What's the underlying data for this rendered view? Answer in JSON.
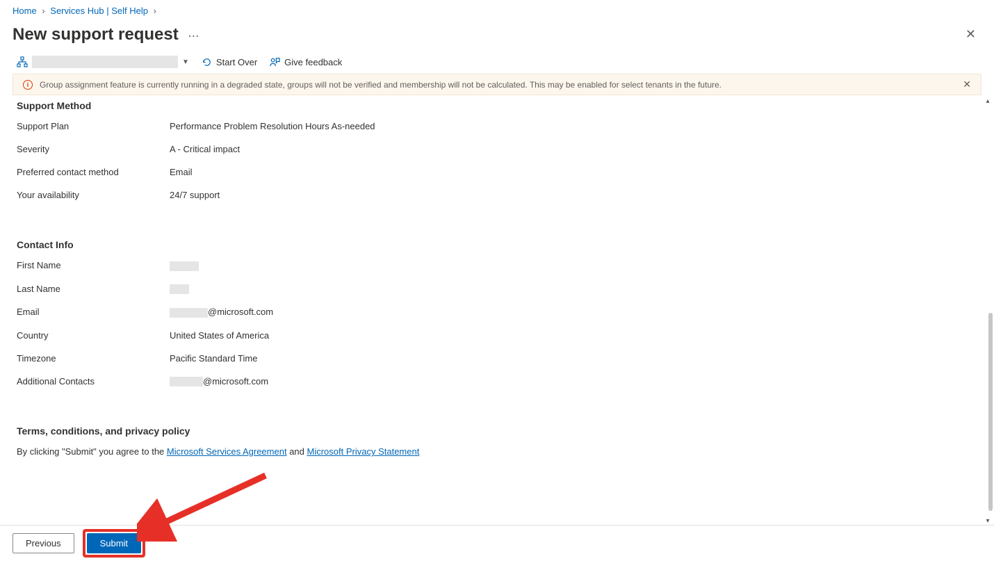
{
  "breadcrumb": {
    "home": "Home",
    "serviceshub": "Services Hub | Self Help"
  },
  "page_title": "New support request",
  "toolbar": {
    "start_over": "Start Over",
    "give_feedback": "Give feedback"
  },
  "notice": {
    "text": "Group assignment feature is currently running in a degraded state, groups will not be verified and membership will not be calculated. This may be enabled for select tenants in the future."
  },
  "support_method": {
    "title": "Support Method",
    "rows": [
      {
        "label": "Support Plan",
        "value": "Performance Problem Resolution Hours As-needed"
      },
      {
        "label": "Severity",
        "value": "A - Critical impact"
      },
      {
        "label": "Preferred contact method",
        "value": "Email"
      },
      {
        "label": "Your availability",
        "value": "24/7 support"
      }
    ]
  },
  "contact_info": {
    "title": "Contact Info",
    "rows": [
      {
        "label": "First Name",
        "value_redacted": "w1",
        "value_suffix": ""
      },
      {
        "label": "Last Name",
        "value_redacted": "w2",
        "value_suffix": ""
      },
      {
        "label": "Email",
        "value_redacted": "w3",
        "value_suffix": "@microsoft.com"
      },
      {
        "label": "Country",
        "value": "United States of America"
      },
      {
        "label": "Timezone",
        "value": "Pacific Standard Time"
      },
      {
        "label": "Additional Contacts",
        "value_redacted": "w4",
        "value_suffix": "@microsoft.com"
      }
    ]
  },
  "terms": {
    "title": "Terms, conditions, and privacy policy",
    "prefix": "By clicking \"Submit\" you agree to the ",
    "link1": "Microsoft Services Agreement",
    "mid": " and ",
    "link2": "Microsoft Privacy Statement"
  },
  "footer": {
    "previous": "Previous",
    "submit": "Submit"
  }
}
